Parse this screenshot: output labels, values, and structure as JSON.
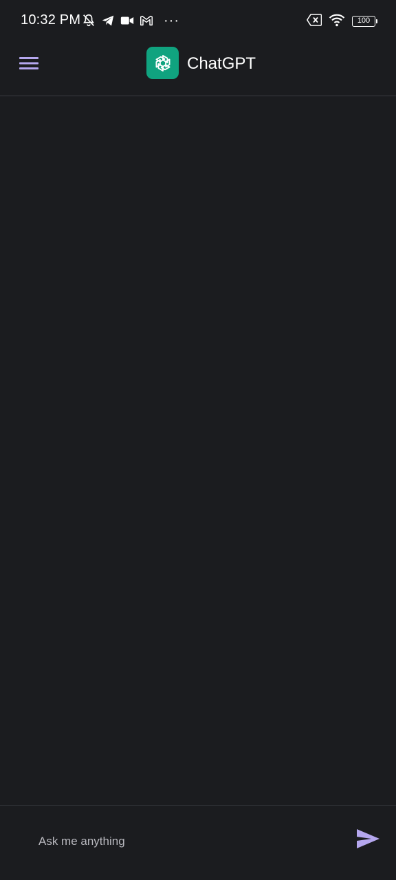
{
  "status_bar": {
    "time": "10:32 PM",
    "dots": "···",
    "battery_level": "100",
    "icons_left": [
      "mute-icon",
      "telegram-icon",
      "video-icon",
      "gmail-icon"
    ],
    "icons_right": [
      "sim-x-icon",
      "wifi-icon",
      "battery-icon"
    ]
  },
  "app_bar": {
    "title": "ChatGPT",
    "menu_icon": "hamburger-menu-icon",
    "logo_icon": "openai-logo-icon"
  },
  "composer": {
    "placeholder": "Ask me anything",
    "value": "",
    "send_icon": "send-icon"
  },
  "colors": {
    "background": "#1b1c1f",
    "accent": "#b5a7ee",
    "logo_bg": "#10a37f",
    "divider": "#3a3c42"
  }
}
